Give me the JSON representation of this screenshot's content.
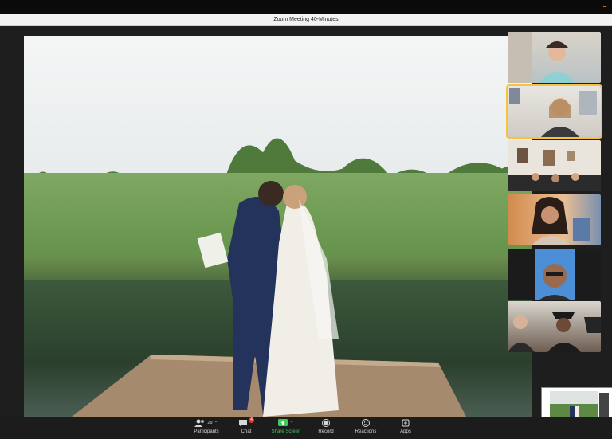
{
  "window": {
    "title": "Zoom Meeting  40-Minutes"
  },
  "main_video": {
    "speaker": "wedding-couple-on-dock"
  },
  "gallery": [
    {
      "id": "participant-1",
      "active": false
    },
    {
      "id": "participant-2",
      "active": true
    },
    {
      "id": "participant-3",
      "active": false
    },
    {
      "id": "participant-4",
      "active": false
    },
    {
      "id": "participant-5",
      "active": false
    },
    {
      "id": "participant-6",
      "active": false
    }
  ],
  "toolbar": {
    "participants_label": "Participants",
    "participants_count": "29",
    "chat_label": "Chat",
    "chat_badge": "4",
    "share_label": "Share Screen",
    "record_label": "Record",
    "reactions_label": "Reactions",
    "apps_label": "Apps",
    "left_caret": "^",
    "left_partial": "e"
  },
  "colors": {
    "share_green": "#3ccb5a",
    "badge_red": "#e5312b",
    "active_border": "#f5c242"
  }
}
